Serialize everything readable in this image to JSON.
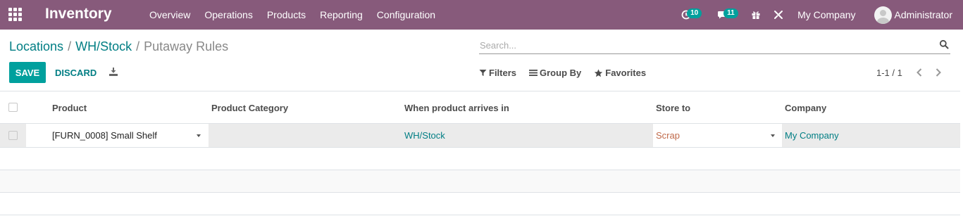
{
  "navbar": {
    "app_title": "Inventory",
    "menu": [
      "Overview",
      "Operations",
      "Products",
      "Reporting",
      "Configuration"
    ],
    "activity_count": "10",
    "messages_count": "11",
    "company": "My Company",
    "user": "Administrator"
  },
  "breadcrumb": {
    "items": [
      "Locations",
      "WH/Stock"
    ],
    "separator": "/",
    "current": "Putaway Rules"
  },
  "search": {
    "placeholder": "Search..."
  },
  "buttons": {
    "save": "SAVE",
    "discard": "DISCARD"
  },
  "filters": {
    "filters": "Filters",
    "group_by": "Group By",
    "favorites": "Favorites"
  },
  "pager": {
    "value": "1-1 / 1"
  },
  "table": {
    "columns": [
      "Product",
      "Product Category",
      "When product arrives in",
      "Store to",
      "Company"
    ],
    "rows": [
      {
        "product": "[FURN_0008] Small Shelf",
        "product_category": "",
        "arrives_in": "WH/Stock",
        "store_to": "Scrap",
        "company": "My Company"
      }
    ]
  },
  "colors": {
    "navbar": "#875a7b",
    "accent": "#00a09d",
    "link": "#017e84",
    "store_to_text": "#c06a4a"
  }
}
